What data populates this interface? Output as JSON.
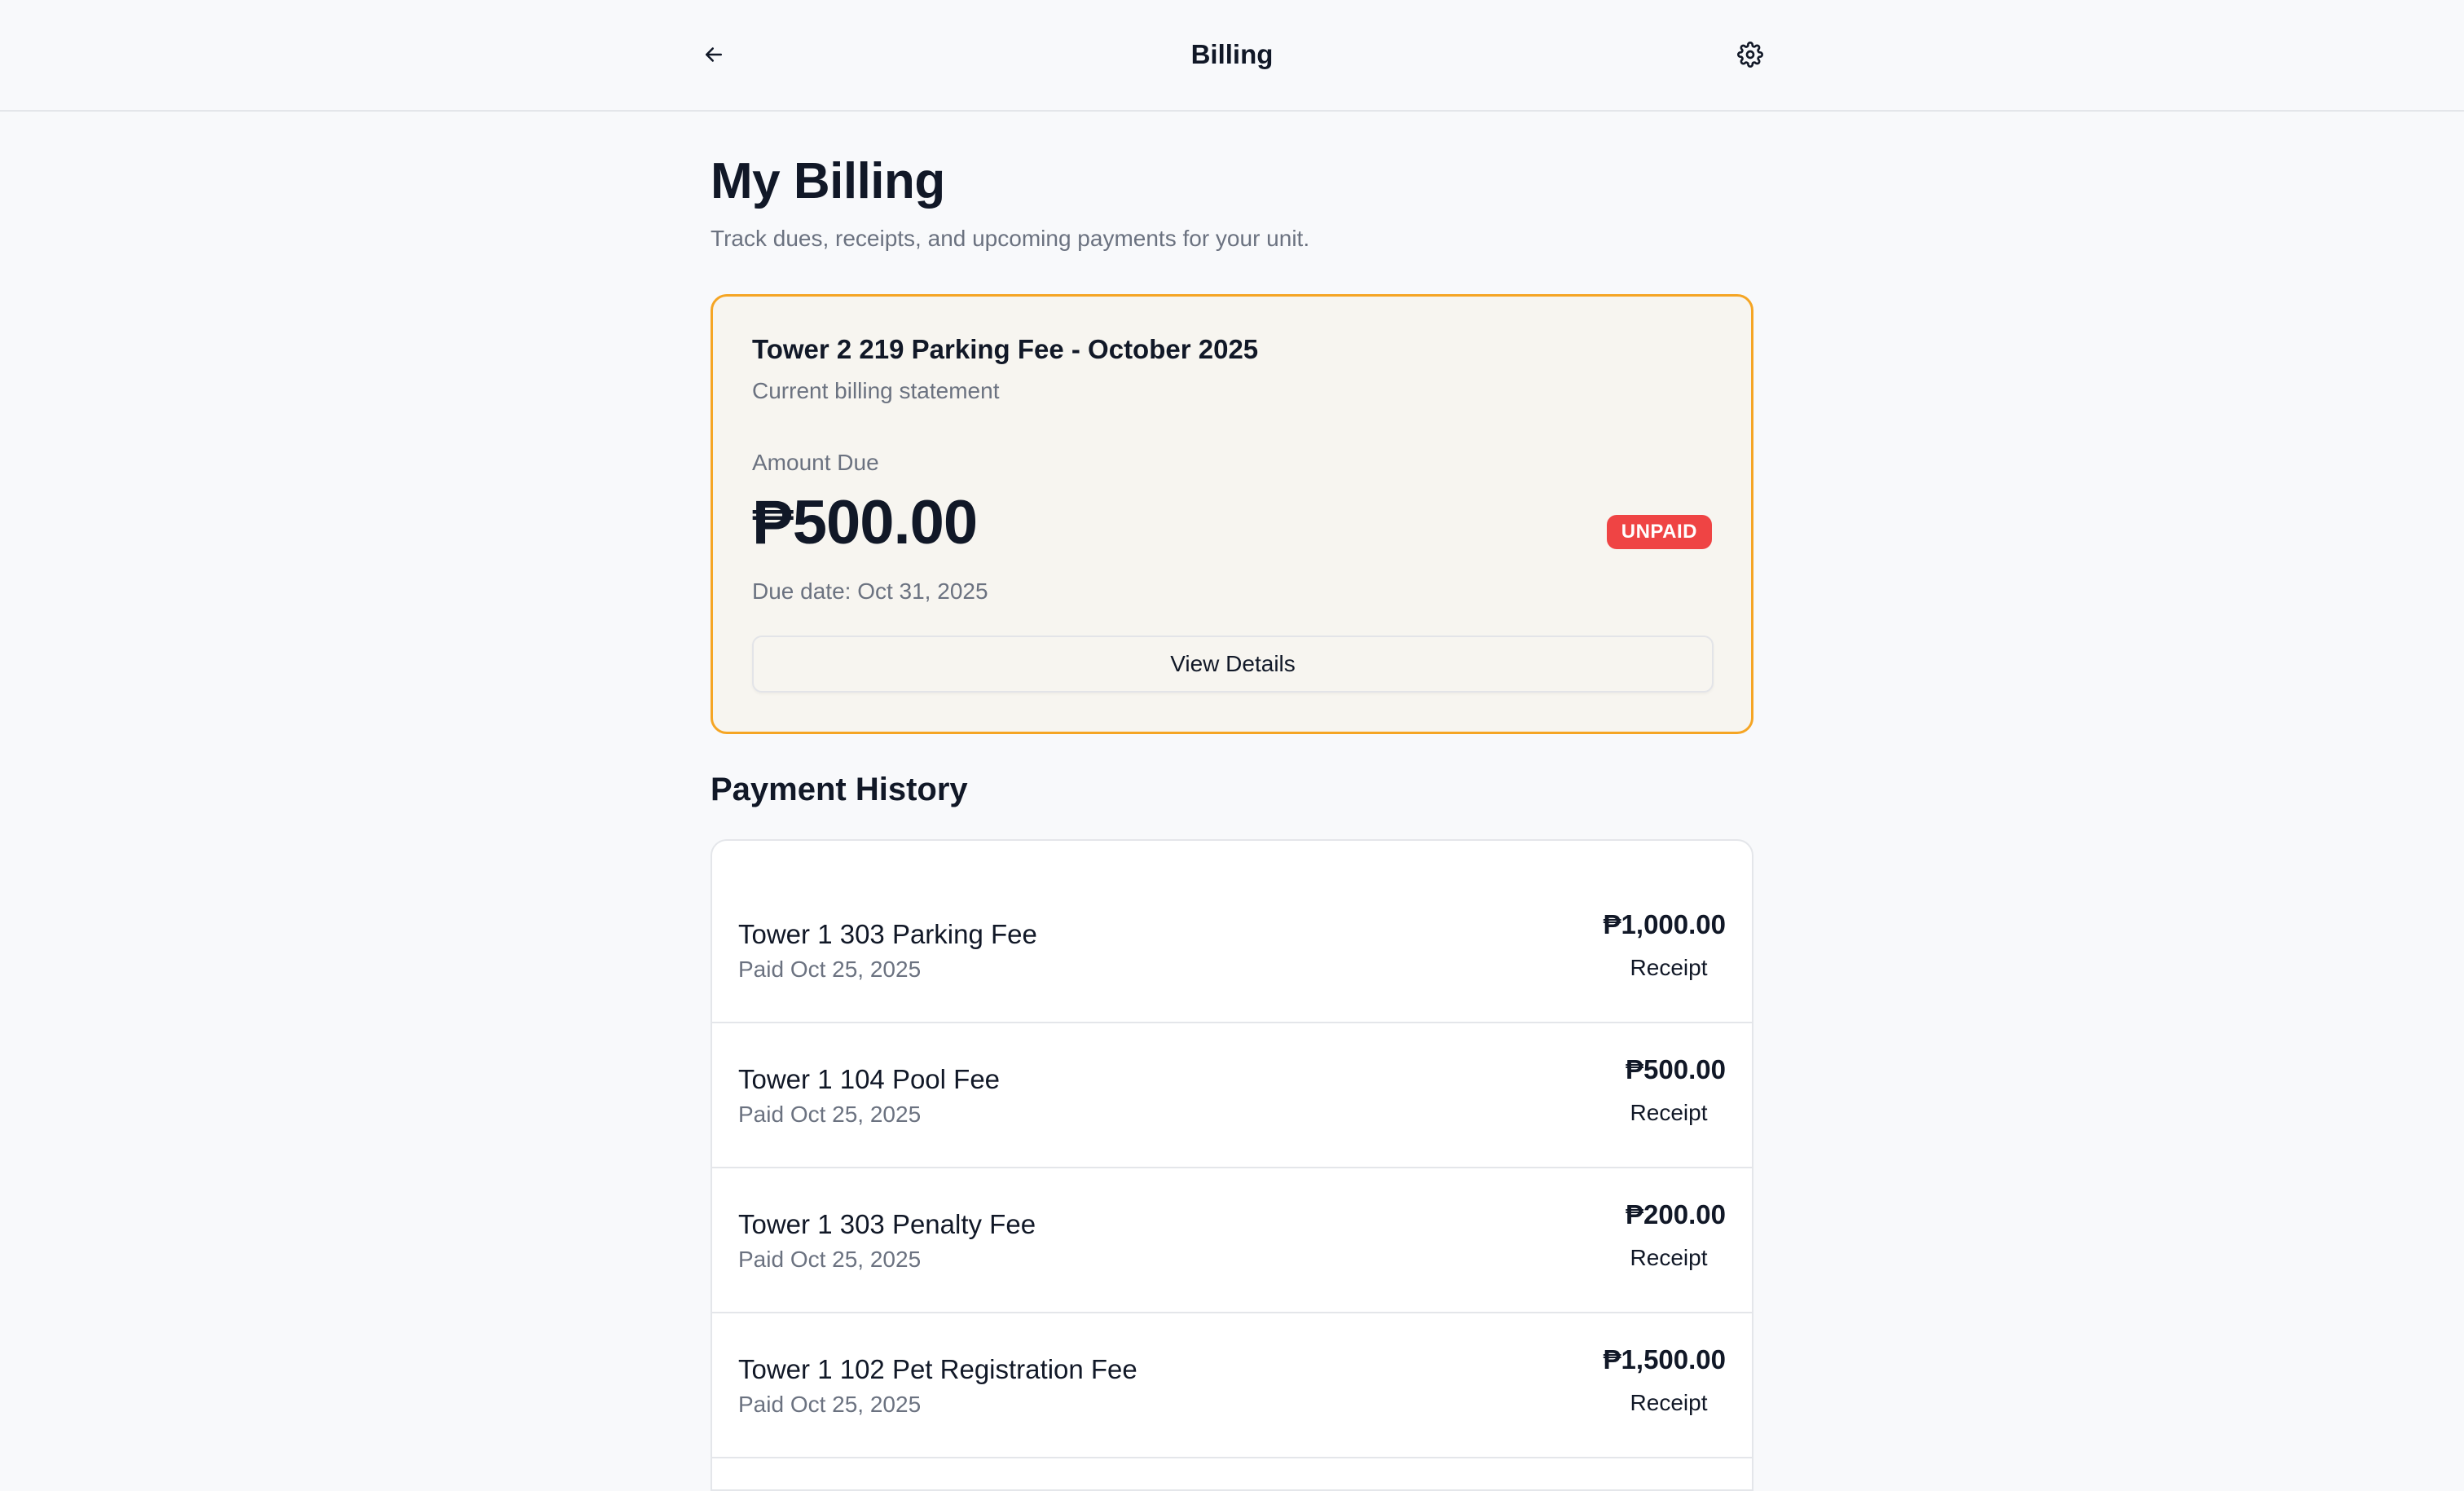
{
  "topbar": {
    "title": "Billing",
    "back_icon": "arrow-left-icon",
    "settings_icon": "gear-icon"
  },
  "header": {
    "title": "My Billing",
    "subtitle": "Track dues, receipts, and upcoming payments for your unit."
  },
  "current_bill": {
    "title": "Tower 2 219 Parking Fee - October 2025",
    "subtitle": "Current billing statement",
    "amount_label": "Amount Due",
    "amount": "₱500.00",
    "status": "UNPAID",
    "due_date": "Due date: Oct 31, 2025",
    "action_label": "View Details"
  },
  "history": {
    "title": "Payment History",
    "items": [
      {
        "title": "Tower 1 303 Parking Fee",
        "date": "Paid Oct 25, 2025",
        "amount": "₱1,000.00",
        "action": "Receipt"
      },
      {
        "title": "Tower 1 104 Pool Fee",
        "date": "Paid Oct 25, 2025",
        "amount": "₱500.00",
        "action": "Receipt"
      },
      {
        "title": "Tower 1 303 Penalty Fee",
        "date": "Paid Oct 25, 2025",
        "amount": "₱200.00",
        "action": "Receipt"
      },
      {
        "title": "Tower 1 102 Pet Registration Fee",
        "date": "Paid Oct 25, 2025",
        "amount": "₱1,500.00",
        "action": "Receipt"
      }
    ]
  },
  "colors": {
    "accent_border": "#f5a524",
    "status_unpaid": "#ef4444",
    "text_primary": "#111827",
    "text_secondary": "#6b7280"
  }
}
